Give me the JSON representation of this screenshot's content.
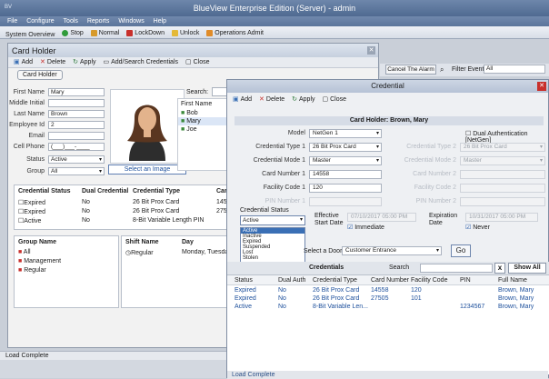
{
  "app": {
    "title": "BlueView Enterprise Edition (Server) - admin",
    "logo": "BV"
  },
  "menu": [
    "File",
    "Configure",
    "Tools",
    "Reports",
    "Windows",
    "Help"
  ],
  "toolbar": {
    "items": [
      "System Overview",
      "Stop",
      "Normal",
      "LockDown",
      "Unlock",
      "Operations Admit"
    ]
  },
  "card_holder": {
    "title": "Card Holder",
    "actions": [
      "Add",
      "Delete",
      "Apply",
      "Add/Search Credentials",
      "Close"
    ],
    "tab": "Card Holder",
    "fields": {
      "first_name": {
        "label": "First Name",
        "value": "Mary"
      },
      "middle": {
        "label": "Middle Initial",
        "value": ""
      },
      "last_name": {
        "label": "Last Name",
        "value": "Brown"
      },
      "employee_id": {
        "label": "Employee Id",
        "value": "2"
      },
      "email": {
        "label": "Email",
        "value": ""
      },
      "cell_phone": {
        "label": "Cell Phone",
        "value": "(___)___-____"
      },
      "status": {
        "label": "Status",
        "value": "Active"
      },
      "group": {
        "label": "Group",
        "value": "All"
      }
    },
    "select_image": "Select an Image",
    "search_label": "Search:",
    "first_name_col": "First Name",
    "names": [
      "Bob",
      "Mary",
      "Joe"
    ],
    "cred_headers": [
      "Credential Status",
      "Dual Credential",
      "Credential Type",
      "Car"
    ],
    "cred_rows": [
      [
        "Expired",
        "No",
        "26 Bit Prox Card",
        "145"
      ],
      [
        "Expired",
        "No",
        "26 Bit Prox Card",
        "275"
      ],
      [
        "Active",
        "No",
        "8-Bit Variable Length PIN",
        ""
      ]
    ],
    "group_header": "Group Name",
    "groups": [
      "All",
      "Management",
      "Regular"
    ],
    "shift_header": "Shift Name",
    "day_header": "Day",
    "shift_row": [
      "Regular",
      "Monday, Tuesda"
    ]
  },
  "alarm": {
    "ack_label": "Cancel The Alarm",
    "filter_label": "Filter Events",
    "filter_value": "All"
  },
  "status_bar": "Load Complete",
  "credential": {
    "title": "Credential",
    "actions": [
      "Add",
      "Delete",
      "Apply",
      "Close"
    ],
    "header": "Card Holder: Brown, Mary",
    "model": {
      "label": "Model",
      "value": "NetGen 1"
    },
    "type1": {
      "label": "Credential Type 1",
      "value": "26 Bit Prox Card"
    },
    "mode1": {
      "label": "Credential Mode 1",
      "value": "Master"
    },
    "card1": {
      "label": "Card Number 1",
      "value": "14558"
    },
    "facility1": {
      "label": "Facility Code 1",
      "value": "120"
    },
    "pin1": {
      "label": "PIN Number 1",
      "value": ""
    },
    "dual_auth": "Dual Authentication [NetGen]",
    "type2": {
      "label": "Credential Type 2",
      "value": "26 Bit Prox Card"
    },
    "mode2": {
      "label": "Credential Mode 2",
      "value": "Master"
    },
    "card2": {
      "label": "Card Number 2"
    },
    "facility2": {
      "label": "Facility Code 2"
    },
    "pin2": {
      "label": "PIN Number 2"
    },
    "status_label": "Credential Status",
    "status_value": "Active",
    "status_options": [
      "Active",
      "Inactive",
      "Expired",
      "Suspended",
      "Lost",
      "Stolen"
    ],
    "effective_label": "Effective Start Date",
    "effective_value": "07/10/2017 05:00 PM",
    "immediate": "Immediate",
    "expiration_label": "Expiration Date",
    "expiration_value": "10/31/2017 05:00 PM",
    "never": "Never",
    "door_label": "Select a Door",
    "door_value": "Customer Entrance",
    "go": "Go",
    "credentials_title": "Credentials",
    "search_label": "Search",
    "clear": "x",
    "show_all": "Show All",
    "grid_headers": [
      "Status",
      "Dual Auth",
      "Credential Type",
      "Card Number",
      "Facility Code",
      "PIN",
      "Full Name"
    ],
    "grid_rows": [
      [
        "Expired",
        "No",
        "26 Bit Prox Card",
        "14558",
        "120",
        "",
        "Brown, Mary"
      ],
      [
        "Expired",
        "No",
        "26 Bit Prox Card",
        "27505",
        "101",
        "",
        "Brown, Mary"
      ],
      [
        "Active",
        "No",
        "8-Bit Variable Len...",
        "",
        "",
        "1234567",
        "Brown, Mary"
      ]
    ],
    "footer": "Load Complete"
  },
  "colors": {
    "accent": "#5b759b",
    "link": "#1b4e9b",
    "close_red": "#c8302c"
  }
}
